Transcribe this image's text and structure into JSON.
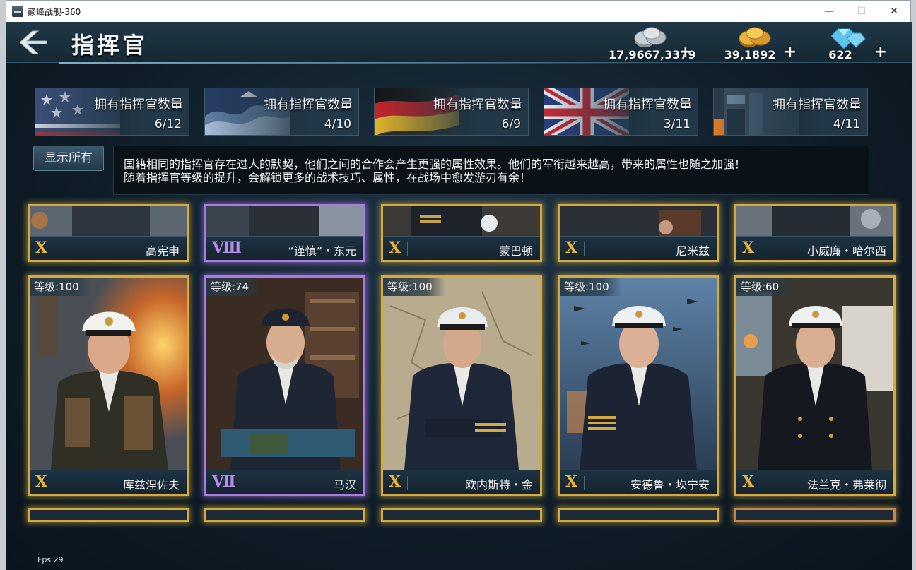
{
  "window": {
    "title": "巅峰战舰-360",
    "controls": {
      "minimize": "—",
      "maximize": "☐",
      "close": "✕"
    }
  },
  "header": {
    "title": "指挥官",
    "back_icon": "back-arrow-icon"
  },
  "currencies": [
    {
      "name": "silver",
      "amount": "17,9667,3379",
      "plus": "+",
      "color": "#b9c0c6"
    },
    {
      "name": "gold",
      "amount": "39,1892",
      "plus": "+",
      "color": "#e0a93a"
    },
    {
      "name": "diamond",
      "amount": "622",
      "plus": "+",
      "color": "#7fd2f2"
    }
  ],
  "nations": [
    {
      "flag": "usa",
      "label": "拥有指挥官数量",
      "count": "6/12"
    },
    {
      "flag": "japan",
      "label": "拥有指挥官数量",
      "count": "4/10"
    },
    {
      "flag": "germany",
      "label": "拥有指挥官数量",
      "count": "6/9"
    },
    {
      "flag": "uk",
      "label": "拥有指挥官数量",
      "count": "3/11"
    },
    {
      "flag": "ussr",
      "label": "拥有指挥官数量",
      "count": "4/11"
    }
  ],
  "show_all": "显示所有",
  "info": {
    "line1": "国籍相同的指挥官存在过人的默契，他们之间的合作会产生更强的属性效果。他们的军衔越来越高，带来的属性也随之加强！",
    "line2": "随着指挥官等级的提升，会解锁更多的战术技巧、属性，在战场中愈发游刃有余！"
  },
  "top_row": [
    {
      "rank": "X",
      "name": "高宪申",
      "tier": "gold"
    },
    {
      "rank": "Ⅷ",
      "name": "“谨慎”・东元",
      "tier": "purple"
    },
    {
      "rank": "X",
      "name": "蒙巴顿",
      "tier": "gold"
    },
    {
      "rank": "X",
      "name": "尼米兹",
      "tier": "gold"
    },
    {
      "rank": "X",
      "name": "小威廉・哈尔西",
      "tier": "gold"
    }
  ],
  "commanders": [
    {
      "level": "等级:100",
      "rank": "X",
      "name": "库兹涅佐夫",
      "tier": "gold"
    },
    {
      "level": "等级:74",
      "rank": "Ⅶ",
      "name": "马汉",
      "tier": "purple"
    },
    {
      "level": "等级:100",
      "rank": "X",
      "name": "欧内斯特・金",
      "tier": "gold"
    },
    {
      "level": "等级:100",
      "rank": "X",
      "name": "安德鲁・坎宁安",
      "tier": "gold"
    },
    {
      "level": "等级:60",
      "rank": "X",
      "name": "法兰克・弗莱彻",
      "tier": "gold"
    }
  ],
  "fps": "Fps 29"
}
